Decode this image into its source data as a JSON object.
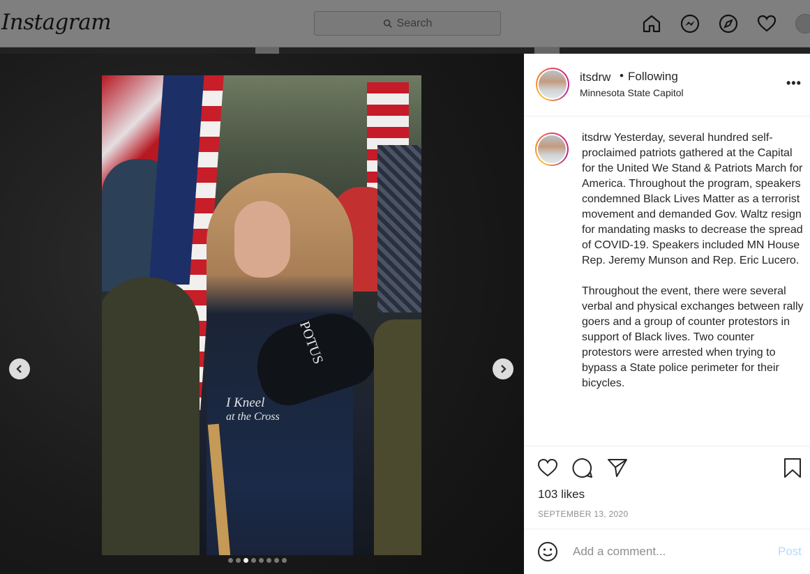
{
  "header": {
    "logo": "Instagram",
    "search_placeholder": "Search",
    "nav_icons": [
      "home-icon",
      "messenger-icon",
      "explore-icon",
      "activity-heart-icon",
      "profile-avatar"
    ]
  },
  "post": {
    "username": "itsdrw",
    "separator": "•",
    "follow_status": "Following",
    "location": "Minnesota State Capitol",
    "more_label": "•••",
    "caption_username": "itsdrw",
    "caption_text": " Yesterday, several hundred self-proclaimed patriots gathered at the Capital for the United We Stand & Patriots March for America. Throughout the program, speakers condemned Black Lives Matter as a terrorist movement and demanded Gov. Waltz resign for mandating masks to decrease the spread of COVID-19. Speakers included MN House Rep. Jeremy Munson and Rep. Eric Lucero.\n\nThroughout the event, there were several verbal and physical exchanges between rally goers and a group of counter protestors in support of Black lives. Two counter protestors were arrested when trying to bypass a State police perimeter for their bicycles.",
    "likes": "103 likes",
    "date": "SEPTEMBER 13, 2020",
    "comment_placeholder": "Add a comment...",
    "post_button": "Post"
  },
  "photo": {
    "hat_text": "POTUS",
    "shirt_text_line1": "I Kneel",
    "shirt_text_line2": "at the Cross"
  },
  "carousel": {
    "slide_count": 8,
    "active_index": 2
  },
  "colors": {
    "post_button_disabled": "#b3dbff",
    "secondary_text": "#8e8e8e",
    "primary_text": "#262626"
  }
}
